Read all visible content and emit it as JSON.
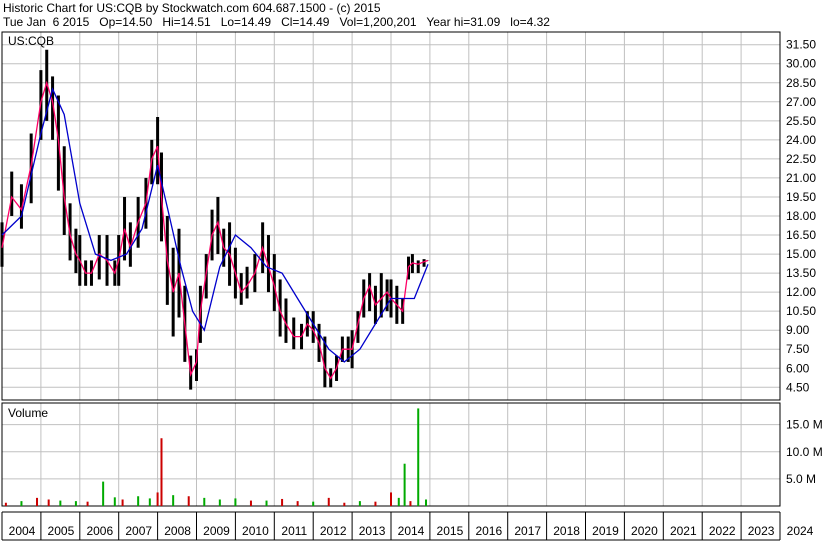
{
  "header": {
    "line1": "Historic Chart for US:CQB by Stockwatch.com 604.687.1500 - (c) 2015",
    "line2": "Tue Jan  6 2015   Op=14.50   Hi=14.51   Lo=14.49   Cl=14.49   Vol=1,200,201   Year hi=31.09   lo=4.32"
  },
  "colors": {
    "background": "#ffffff",
    "grid": "#c0c0c0",
    "price_bar": "#000000",
    "ma_short": "#ff0066",
    "ma_long": "#0000cc",
    "volume_up": "#00aa00",
    "volume_down": "#cc0000"
  },
  "chart_data": [
    {
      "type": "line",
      "title": "US:CQB",
      "y_tick_labels": [
        "31.50",
        "30.00",
        "28.50",
        "27.00",
        "25.50",
        "24.00",
        "22.50",
        "21.00",
        "19.50",
        "18.00",
        "16.50",
        "15.00",
        "13.50",
        "12.00",
        "10.50",
        "9.00",
        "7.50",
        "6.00",
        "4.50"
      ],
      "ylim": [
        3.5,
        32.5
      ],
      "x_tick_labels": [
        "2004",
        "2005",
        "2006",
        "2007",
        "2008",
        "2009",
        "2010",
        "2011",
        "2012",
        "2013",
        "2014",
        "2015",
        "2016",
        "2017",
        "2018",
        "2019",
        "2020",
        "2021",
        "2022",
        "2023",
        "2024"
      ],
      "xlim": [
        2004.0,
        2024.0
      ],
      "grid": true,
      "series": [
        {
          "style": "high-low bars",
          "x": [
            2004.0,
            2004.25,
            2004.5,
            2004.75,
            2005.0,
            2005.15,
            2005.3,
            2005.45,
            2005.6,
            2005.75,
            2005.9,
            2006.0,
            2006.15,
            2006.3,
            2006.5,
            2006.7,
            2006.9,
            2007.0,
            2007.15,
            2007.3,
            2007.5,
            2007.7,
            2007.85,
            2008.0,
            2008.1,
            2008.25,
            2008.4,
            2008.55,
            2008.7,
            2008.85,
            2009.0,
            2009.1,
            2009.25,
            2009.4,
            2009.55,
            2009.7,
            2009.85,
            2010.0,
            2010.15,
            2010.3,
            2010.5,
            2010.7,
            2010.85,
            2011.0,
            2011.15,
            2011.3,
            2011.5,
            2011.7,
            2011.85,
            2012.0,
            2012.15,
            2012.3,
            2012.45,
            2012.6,
            2012.75,
            2012.9,
            2013.0,
            2013.15,
            2013.3,
            2013.45,
            2013.6,
            2013.75,
            2013.9,
            2014.0,
            2014.15,
            2014.3,
            2014.45,
            2014.55,
            2014.7,
            2014.85,
            2014.95
          ],
          "high": [
            17.5,
            21.5,
            20.5,
            24.5,
            29.5,
            31.1,
            29.0,
            27.5,
            23.5,
            19.0,
            17.0,
            16.5,
            14.5,
            14.5,
            16.5,
            16.5,
            14.5,
            16.5,
            19.5,
            17.5,
            19.5,
            21.0,
            24.0,
            25.8,
            23.0,
            18.0,
            15.5,
            17.0,
            12.5,
            7.0,
            7.5,
            12.5,
            15.0,
            18.5,
            19.5,
            17.0,
            17.5,
            15.5,
            13.5,
            14.0,
            15.0,
            17.5,
            16.5,
            15.0,
            13.0,
            11.5,
            10.0,
            9.5,
            10.5,
            10.5,
            9.5,
            8.5,
            6.0,
            7.0,
            8.5,
            8.5,
            9.0,
            10.5,
            13.0,
            13.5,
            12.5,
            13.5,
            13.0,
            13.0,
            12.5,
            11.5,
            14.8,
            15.0,
            14.5,
            14.6,
            14.51
          ],
          "low": [
            14.0,
            18.0,
            17.0,
            19.0,
            24.0,
            25.5,
            24.0,
            20.0,
            16.5,
            14.5,
            13.5,
            12.5,
            12.5,
            12.5,
            13.0,
            12.5,
            12.5,
            12.5,
            14.5,
            14.0,
            15.5,
            17.0,
            20.5,
            20.5,
            16.0,
            11.0,
            8.5,
            10.0,
            6.5,
            4.32,
            5.0,
            8.0,
            11.5,
            14.5,
            15.0,
            14.0,
            12.5,
            11.5,
            11.0,
            11.5,
            12.0,
            13.5,
            12.0,
            10.5,
            8.5,
            8.0,
            7.5,
            7.5,
            8.5,
            8.0,
            6.5,
            4.5,
            4.5,
            5.0,
            6.5,
            6.5,
            6.0,
            8.0,
            10.0,
            10.5,
            9.5,
            10.0,
            10.5,
            10.0,
            9.5,
            9.5,
            13.0,
            13.5,
            13.5,
            14.0,
            14.49
          ]
        },
        {
          "style": "line",
          "color_key": "ma_short",
          "x": [
            2004.0,
            2004.25,
            2004.5,
            2004.75,
            2005.0,
            2005.15,
            2005.3,
            2005.45,
            2005.6,
            2005.75,
            2005.9,
            2006.0,
            2006.15,
            2006.3,
            2006.5,
            2006.7,
            2006.9,
            2007.0,
            2007.15,
            2007.3,
            2007.5,
            2007.7,
            2007.85,
            2008.0,
            2008.1,
            2008.25,
            2008.4,
            2008.55,
            2008.7,
            2008.85,
            2009.0,
            2009.1,
            2009.25,
            2009.4,
            2009.55,
            2009.7,
            2009.85,
            2010.0,
            2010.15,
            2010.3,
            2010.5,
            2010.7,
            2010.85,
            2011.0,
            2011.15,
            2011.3,
            2011.5,
            2011.7,
            2011.85,
            2012.0,
            2012.15,
            2012.3,
            2012.45,
            2012.6,
            2012.75,
            2012.9,
            2013.0,
            2013.15,
            2013.3,
            2013.45,
            2013.6,
            2013.75,
            2013.9,
            2014.0,
            2014.15,
            2014.3,
            2014.45,
            2014.55,
            2014.7,
            2014.85,
            2014.95
          ],
          "values": [
            15.5,
            19.5,
            18.5,
            22.0,
            27.0,
            28.5,
            27.0,
            24.0,
            19.5,
            16.5,
            15.0,
            14.5,
            13.5,
            13.5,
            15.0,
            14.5,
            13.5,
            14.5,
            17.0,
            15.5,
            17.5,
            19.0,
            22.5,
            23.5,
            19.5,
            14.5,
            12.0,
            13.5,
            9.5,
            5.5,
            6.5,
            10.5,
            13.5,
            16.5,
            17.5,
            15.5,
            15.0,
            13.5,
            12.0,
            12.5,
            13.5,
            15.5,
            14.0,
            12.5,
            10.5,
            9.5,
            8.5,
            8.5,
            9.5,
            9.0,
            8.0,
            6.0,
            5.2,
            6.0,
            7.5,
            7.5,
            7.5,
            9.5,
            11.5,
            12.5,
            11.0,
            11.5,
            12.0,
            11.5,
            11.0,
            10.5,
            14.0,
            14.3,
            14.2,
            14.4,
            14.49
          ]
        },
        {
          "style": "line",
          "color_key": "ma_long",
          "x": [
            2004.0,
            2004.5,
            2005.0,
            2005.3,
            2005.6,
            2006.0,
            2006.4,
            2006.8,
            2007.2,
            2007.6,
            2008.0,
            2008.3,
            2008.6,
            2008.9,
            2009.2,
            2009.6,
            2010.0,
            2010.4,
            2010.8,
            2011.2,
            2011.6,
            2012.0,
            2012.4,
            2012.8,
            2013.2,
            2013.6,
            2014.0,
            2014.3,
            2014.6,
            2014.95
          ],
          "values": [
            16.5,
            18.0,
            24.5,
            28.0,
            26.0,
            19.0,
            15.0,
            14.5,
            15.0,
            17.0,
            22.0,
            18.0,
            14.0,
            10.5,
            9.0,
            14.0,
            16.5,
            15.5,
            14.0,
            13.5,
            11.5,
            9.5,
            7.5,
            6.5,
            7.5,
            9.5,
            11.5,
            11.5,
            11.5,
            14.2
          ]
        }
      ]
    },
    {
      "type": "bar",
      "title": "Volume",
      "y_tick_labels": [
        "15.0 M",
        "10.0 M",
        "5.0 M"
      ],
      "ylim": [
        0,
        19000000
      ],
      "grid": true,
      "series": [
        {
          "name": "Volume",
          "x": [
            2004.1,
            2004.5,
            2004.9,
            2005.2,
            2005.5,
            2005.9,
            2006.2,
            2006.6,
            2006.9,
            2007.1,
            2007.5,
            2007.8,
            2008.0,
            2008.1,
            2008.4,
            2008.8,
            2009.2,
            2009.6,
            2010.0,
            2010.4,
            2010.8,
            2011.2,
            2011.6,
            2012.0,
            2012.4,
            2012.8,
            2013.2,
            2013.6,
            2014.0,
            2014.2,
            2014.35,
            2014.5,
            2014.7,
            2014.9
          ],
          "values": [
            600000,
            900000,
            1500000,
            1200000,
            1000000,
            900000,
            800000,
            4500000,
            1600000,
            1200000,
            1800000,
            1400000,
            2500000,
            12500000,
            2000000,
            1800000,
            1500000,
            1200000,
            1400000,
            1000000,
            1000000,
            1300000,
            900000,
            800000,
            1500000,
            600000,
            900000,
            800000,
            2500000,
            1500000,
            7800000,
            900000,
            18000000,
            1200000
          ],
          "colors": [
            "#cc0000",
            "#00aa00",
            "#cc0000",
            "#cc0000",
            "#00aa00",
            "#00aa00",
            "#cc0000",
            "#00aa00",
            "#00aa00",
            "#cc0000",
            "#00aa00",
            "#00aa00",
            "#cc0000",
            "#cc0000",
            "#00aa00",
            "#cc0000",
            "#00aa00",
            "#00aa00",
            "#00aa00",
            "#cc0000",
            "#00aa00",
            "#cc0000",
            "#cc0000",
            "#00aa00",
            "#cc0000",
            "#cc0000",
            "#00aa00",
            "#cc0000",
            "#cc0000",
            "#00aa00",
            "#00aa00",
            "#cc0000",
            "#00aa00",
            "#00aa00"
          ]
        }
      ]
    }
  ]
}
